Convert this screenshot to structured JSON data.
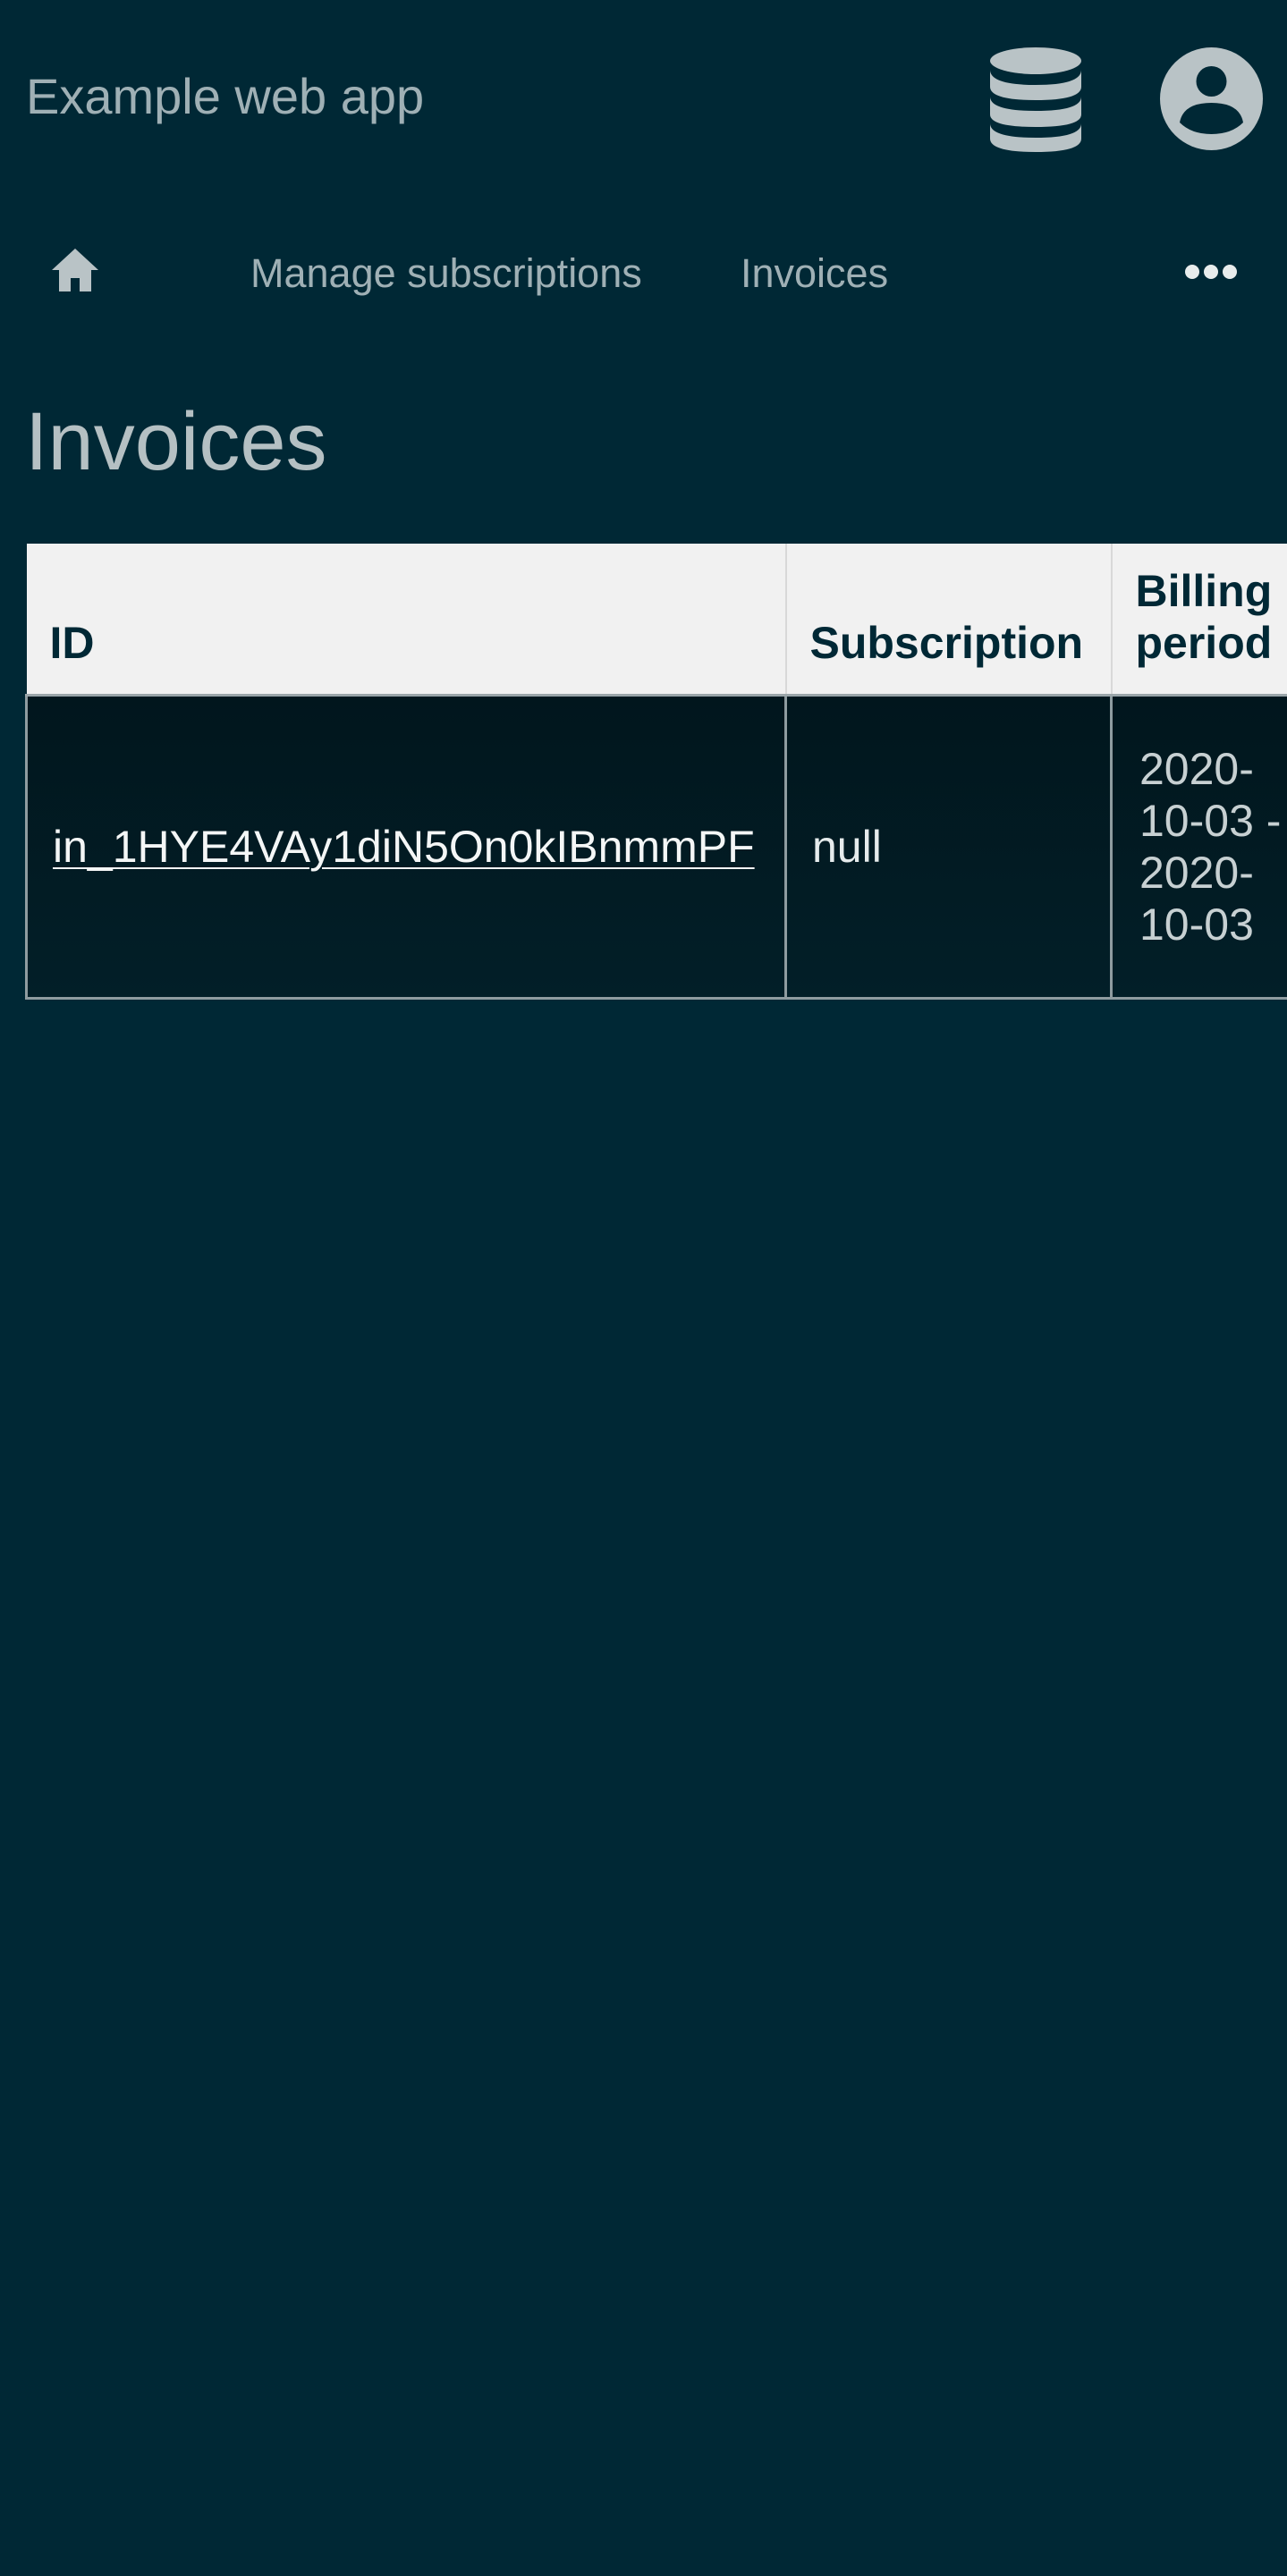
{
  "header": {
    "app_title": "Example web app",
    "icons": [
      "database-icon",
      "user-account-icon"
    ]
  },
  "nav": {
    "home_icon": "home-icon",
    "items": [
      {
        "label": "Manage subscriptions"
      },
      {
        "label": "Invoices"
      }
    ],
    "more_icon": "more-horizontal-icon"
  },
  "page": {
    "title": "Invoices"
  },
  "table": {
    "columns": [
      "ID",
      "Subscription",
      "Billing period"
    ],
    "rows": [
      {
        "id": "in_1HYE4VAy1diN5On0kIBnmmPF",
        "subscription": "null",
        "billing_period": "2020-10-03 - 2020-10-03"
      }
    ]
  },
  "colors": {
    "background": "#002835",
    "header_cell": "#f1f1f1",
    "text_muted": "#9fb0b5",
    "link": "#f4f6f6"
  }
}
